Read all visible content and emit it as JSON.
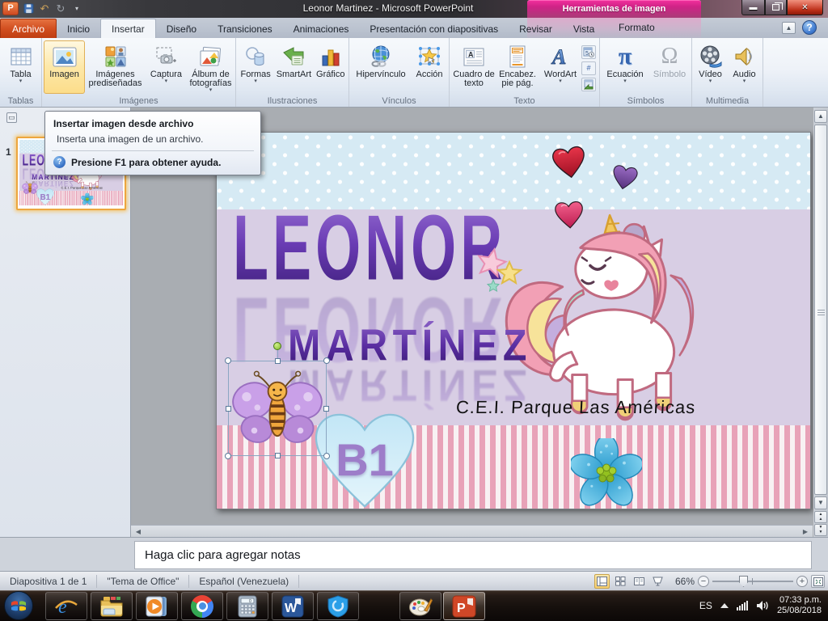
{
  "window": {
    "title": "Leonor Martinez  -  Microsoft PowerPoint",
    "context_tab_group": "Herramientas de imagen"
  },
  "tabs": [
    {
      "label": "Archivo"
    },
    {
      "label": "Inicio"
    },
    {
      "label": "Insertar"
    },
    {
      "label": "Diseño"
    },
    {
      "label": "Transiciones"
    },
    {
      "label": "Animaciones"
    },
    {
      "label": "Presentación con diapositivas"
    },
    {
      "label": "Revisar"
    },
    {
      "label": "Vista"
    },
    {
      "label": "Formato"
    }
  ],
  "ribbon": {
    "groups": {
      "tablas": "Tablas",
      "imagenes": "Imágenes",
      "ilustraciones": "Ilustraciones",
      "vinculos": "Vínculos",
      "texto": "Texto",
      "simbolos": "Símbolos",
      "multimedia": "Multimedia"
    },
    "buttons": {
      "tabla": "Tabla",
      "imagen": "Imagen",
      "imagenes_pred": "Imágenes prediseñadas",
      "captura": "Captura",
      "album": "Álbum de fotografías",
      "formas": "Formas",
      "smartart": "SmartArt",
      "grafico": "Gráfico",
      "hipervinculo": "Hipervínculo",
      "accion": "Acción",
      "cuadro": "Cuadro de texto",
      "encabez": "Encabez. pie pág.",
      "wordart": "WordArt",
      "ecuacion": "Ecuación",
      "simbolo": "Símbolo",
      "video": "Vídeo",
      "audio": "Audio"
    },
    "glyphs": {
      "pi": "π",
      "omega": "Ω",
      "hash": "#"
    }
  },
  "tooltip": {
    "title": "Insertar imagen desde archivo",
    "description": "Inserta una imagen de un archivo.",
    "help": "Presione F1 para obtener ayuda."
  },
  "slides_panel": {
    "slide_number": "1"
  },
  "slide": {
    "name_line1": "LEONOR",
    "name_line2": "MARTÍNEZ",
    "school": "C.E.I.  Parque  Las  Américas",
    "badge": "B1"
  },
  "notes": {
    "placeholder": "Haga clic para agregar notas"
  },
  "status_bar": {
    "slide_info": "Diapositiva 1 de 1",
    "theme": "\"Tema de Office\"",
    "language": "Español (Venezuela)",
    "zoom_level": "66%"
  },
  "taskbar": {
    "language_indicator": "ES",
    "time": "07:33 p.m.",
    "date": "25/08/2018"
  },
  "colors": {
    "context_tab_pink": "#cf2386",
    "archivo_orange": "#d24f20",
    "hover_highlight": "#fde8a8",
    "name_purple": "#5a2ea2",
    "slide_lavender": "#d8cee4",
    "slide_blue_band": "#d6eaf4",
    "stripe_pink": "#e8a2b8"
  }
}
